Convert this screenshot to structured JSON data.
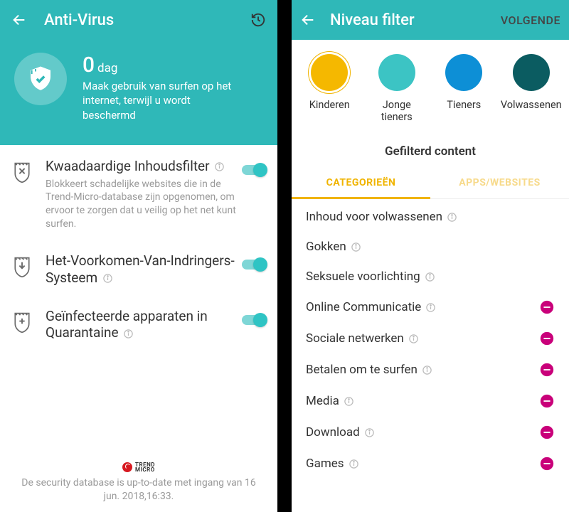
{
  "left": {
    "title": "Anti-Virus",
    "hero": {
      "count": "0",
      "unit": "dag",
      "sub": "Maak gebruik van surfen op het internet, terwijl u wordt beschermd"
    },
    "settings": [
      {
        "title": "Kwaadaardige Inhoudsfilter",
        "desc": "Blokkeert schadelijke websites die in de Trend-Micro-database zijn opgenomen, om ervoor te zorgen dat u veilig op het net kunt surfen.",
        "on": true
      },
      {
        "title": "Het-Voorkomen-Van-Indringers-Systeem",
        "desc": "",
        "on": true
      },
      {
        "title": "Geïnfecteerde apparaten in Quarantaine",
        "desc": "",
        "on": true
      }
    ],
    "brand": "TREND MICRO",
    "footer": "De security database is up-to-date met ingang van 16 jun. 2018,16:33."
  },
  "right": {
    "title": "Niveau filter",
    "next": "VOLGENDE",
    "levels": [
      {
        "label": "Kinderen",
        "color": "#f5b800",
        "selected": true
      },
      {
        "label": "Jonge tieners",
        "color": "#3cc4c4",
        "selected": false
      },
      {
        "label": "Tieners",
        "color": "#0d8fd6",
        "selected": false
      },
      {
        "label": "Volwassenen",
        "color": "#0b5c61",
        "selected": false
      }
    ],
    "sectionTitle": "Gefilterd content",
    "tabs": {
      "active": "CATEGORIEËN",
      "inactive": "APPS/WEBSITES"
    },
    "categories": [
      {
        "label": "Inhoud voor volwassenen",
        "removable": false
      },
      {
        "label": "Gokken",
        "removable": false
      },
      {
        "label": "Seksuele voorlichting",
        "removable": false
      },
      {
        "label": "Online Communicatie",
        "removable": true
      },
      {
        "label": "Sociale netwerken",
        "removable": true
      },
      {
        "label": "Betalen om te surfen",
        "removable": true
      },
      {
        "label": "Media",
        "removable": true
      },
      {
        "label": "Download",
        "removable": true
      },
      {
        "label": "Games",
        "removable": true
      }
    ]
  }
}
